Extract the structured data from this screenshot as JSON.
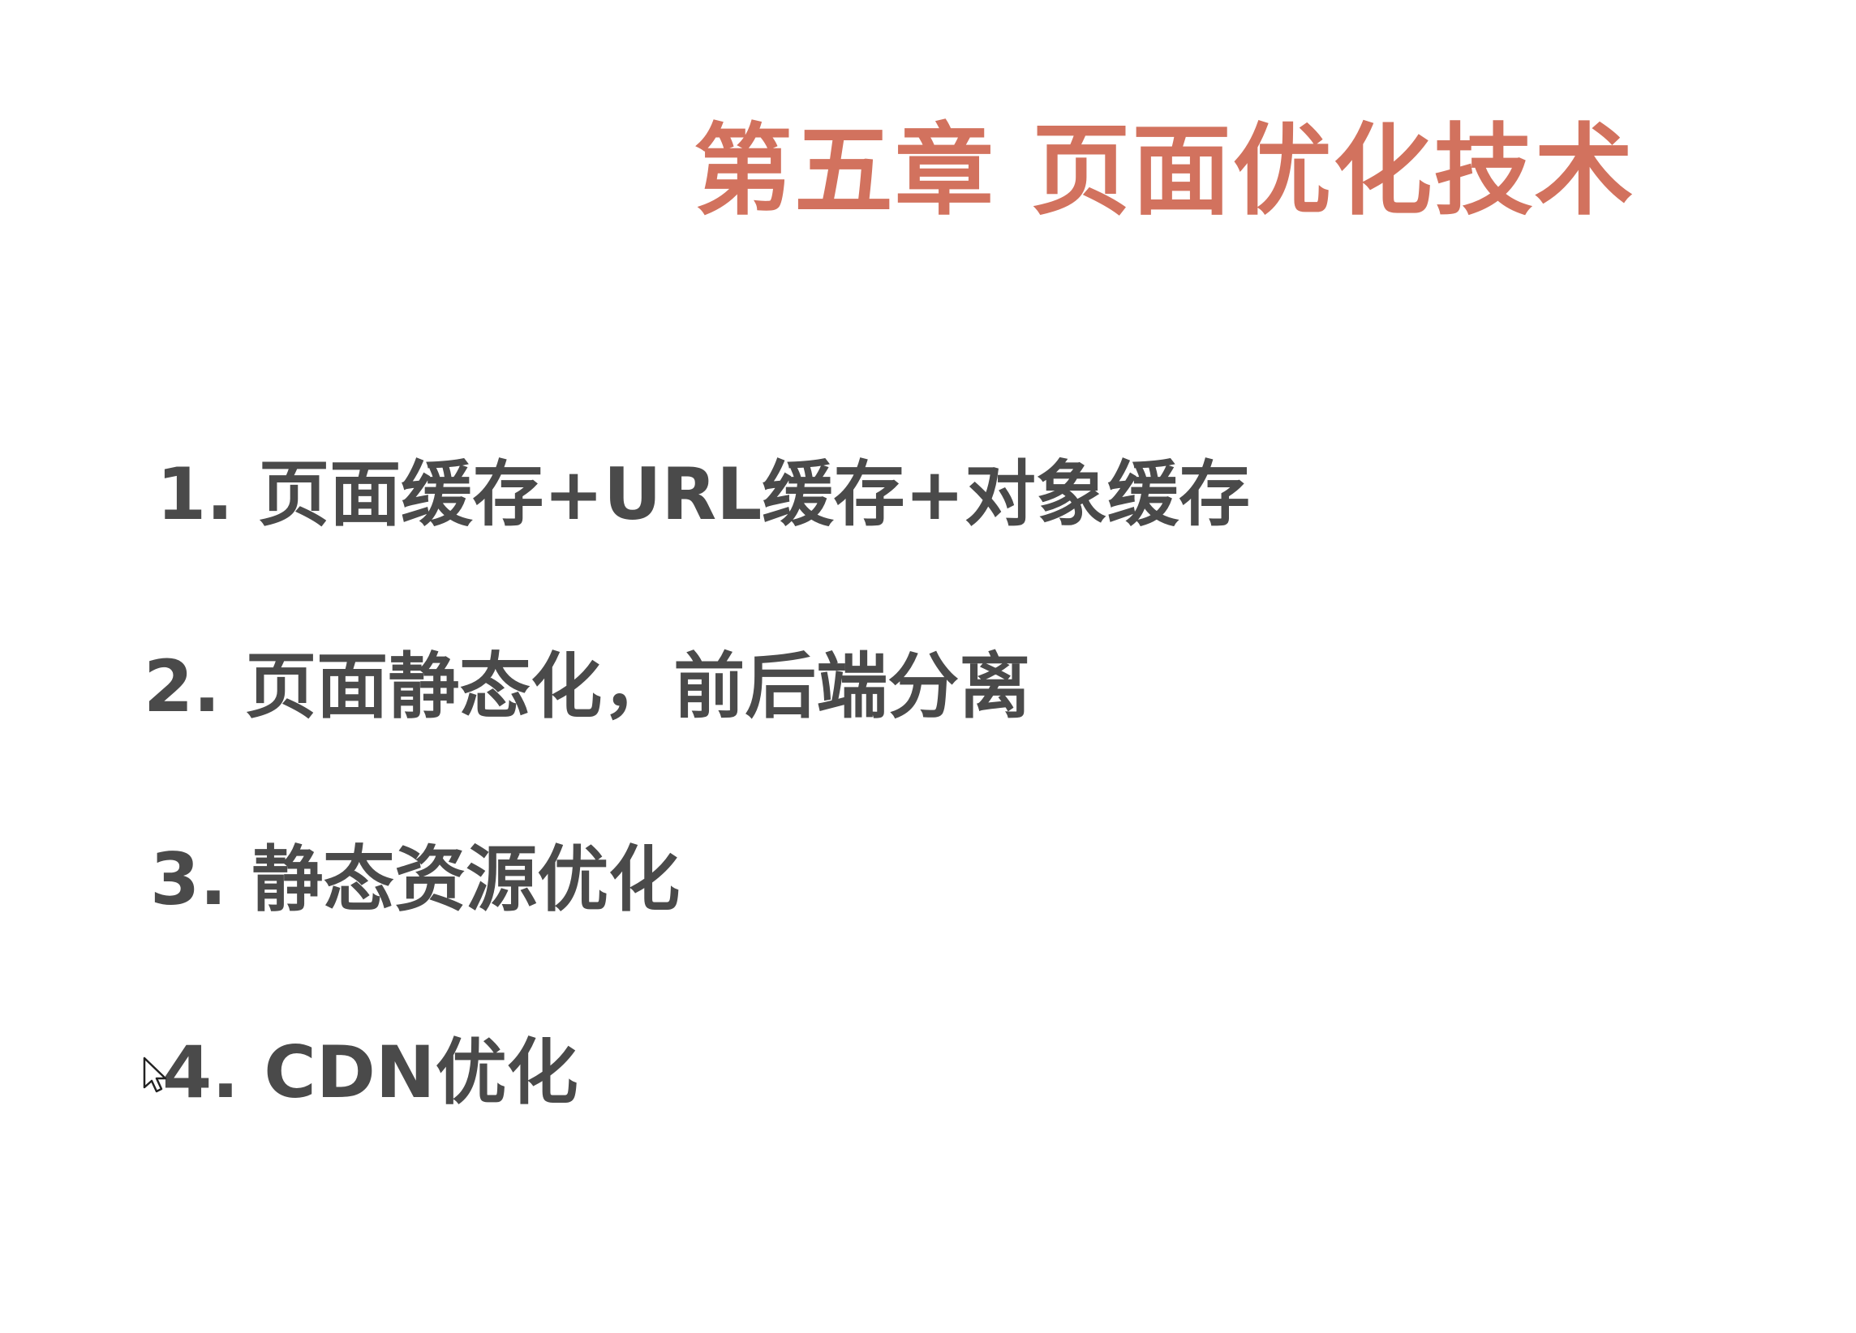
{
  "slide": {
    "title": "第五章 页面优化技术",
    "items": [
      "1. 页面缓存+URL缓存+对象缓存",
      "2. 页面静态化，前后端分离",
      "3. 静态资源优化",
      "4. CDN优化"
    ]
  },
  "colors": {
    "title": "#d2725e",
    "text": "#4a4a4a",
    "background": "#ffffff"
  },
  "icons": {
    "cursor": "mouse-pointer-icon"
  }
}
